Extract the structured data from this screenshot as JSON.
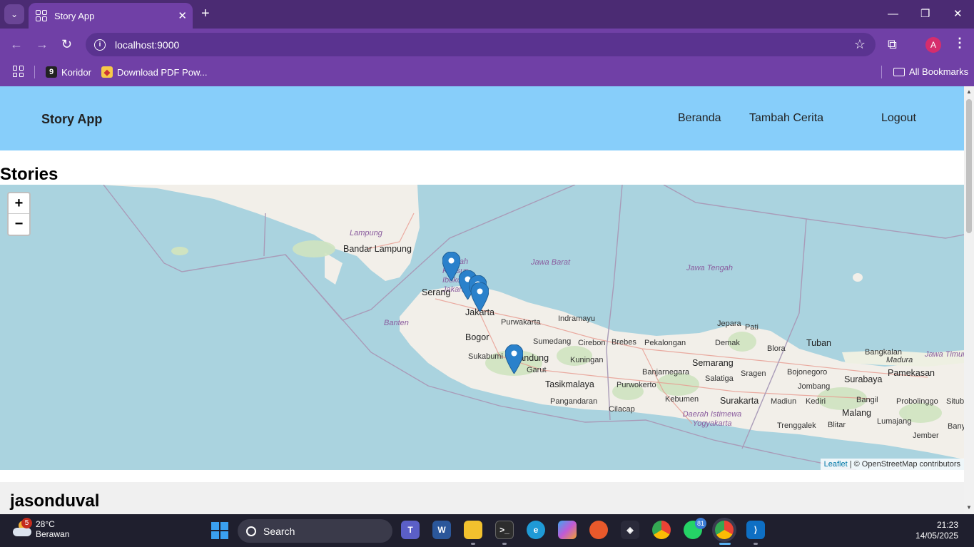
{
  "browser": {
    "tab_title": "Story App",
    "url": "localhost:9000",
    "bookmarks": [
      "Koridor",
      "Download PDF Pow..."
    ],
    "all_bookmarks": "All Bookmarks",
    "profile_initial": "A"
  },
  "site": {
    "brand": "Story App",
    "nav": [
      "Beranda",
      "Tambah Cerita",
      "Logout"
    ],
    "heading": "Stories"
  },
  "map": {
    "zoom_in": "+",
    "zoom_out": "−",
    "attribution_link": "Leaflet",
    "attribution_text": "| © OpenStreetMap contributors",
    "places": {
      "lampung": "Lampung",
      "bandar_lampung": "Bandar Lampung",
      "dki": "Daerah Khusus Ibukota Jakarta",
      "jawa_barat": "Jawa Barat",
      "jawa_tengah": "Jawa Tengah",
      "serang": "Serang",
      "jakarta": "Jakarta",
      "banten": "Banten",
      "indramayu": "Indramayu",
      "purwakarta": "Purwakarta",
      "bogor": "Bogor",
      "sumedang": "Sumedang",
      "cirebon": "Cirebon",
      "brebes": "Brebes",
      "pekalongan": "Pekalongan",
      "jepara": "Jepara",
      "pati": "Pati",
      "tuban": "Tuban",
      "bangkalan": "Bangkalan",
      "madura": "Madura",
      "jawa_timur": "Jawa Timur",
      "demak": "Demak",
      "blora": "Blora",
      "sukabumi": "Sukabumi",
      "bandung": "Bandung",
      "garut": "Garut",
      "kuningan": "Kuningan",
      "semarang": "Semarang",
      "banjarnegara": "Banjarnegara",
      "bojonegoro": "Bojonegoro",
      "pamekasan": "Pamekasan",
      "tasikmalaya": "Tasikmalaya",
      "purwokerto": "Purwokerto",
      "salatiga": "Salatiga",
      "sragen": "Sragen",
      "jombang": "Jombang",
      "surabaya": "Surabaya",
      "pangandaran": "Pangandaran",
      "kebumen": "Kebumen",
      "surakarta": "Surakarta",
      "madiun": "Madiun",
      "kediri": "Kediri",
      "bangil": "Bangil",
      "probolinggo": "Probolinggo",
      "situbondo": "Situb",
      "cilacap": "Cilacap",
      "diy": "Daerah Istimewa Yogyakarta",
      "malang": "Malang",
      "trenggalek": "Trenggalek",
      "blitar": "Blitar",
      "lumajang": "Lumajang",
      "jember": "Jember",
      "banyuwangi": "Bany"
    }
  },
  "stories": [
    {
      "name": "jasonduval"
    }
  ],
  "taskbar": {
    "weather_temp": "28°C",
    "weather_desc": "Berawan",
    "weather_badge": "5",
    "search_placeholder": "Search",
    "whatsapp_badge": "81",
    "time": "21:23",
    "date": "14/05/2025"
  },
  "colors": {
    "header_bg": "#87cefa",
    "browser_chrome": "#7040a6",
    "map_water": "#aad3df",
    "map_land": "#f2efe9",
    "marker": "#2a81cb"
  }
}
